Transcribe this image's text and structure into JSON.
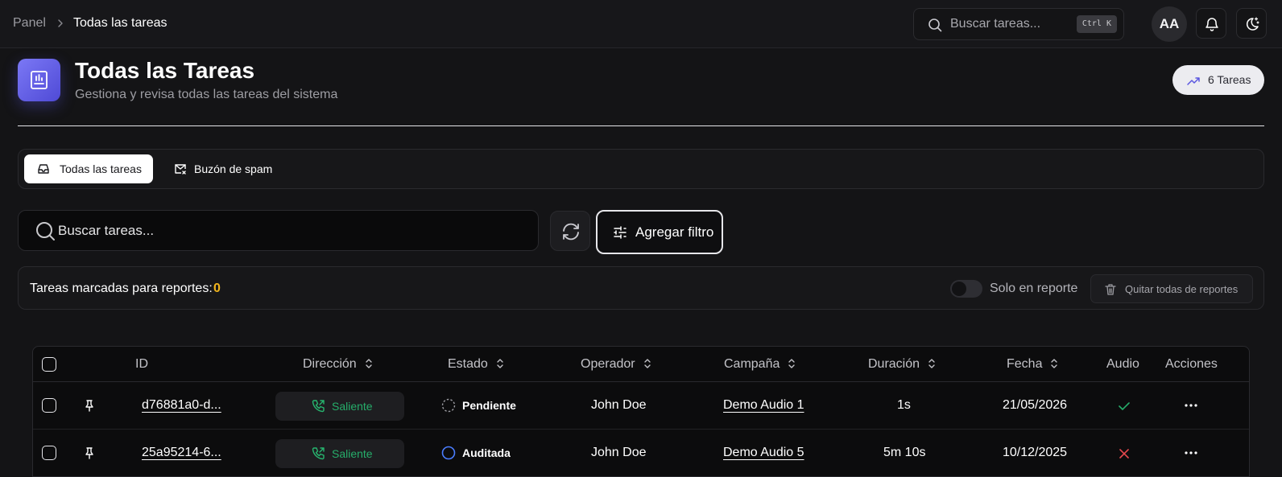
{
  "breadcrumb": {
    "parent": "Panel",
    "current": "Todas las tareas"
  },
  "top_search": {
    "placeholder": "Buscar tareas...",
    "shortcut": "Ctrl K"
  },
  "user": {
    "initials": "AA"
  },
  "header": {
    "title": "Todas las Tareas",
    "subtitle": "Gestiona y revisa todas las tareas del sistema",
    "count_label": "6 Tareas"
  },
  "tabs": [
    {
      "label": "Todas las tareas",
      "icon": "inbox-icon",
      "active": true
    },
    {
      "label": "Buzón de spam",
      "icon": "mail-x-icon",
      "active": false
    }
  ],
  "search": {
    "placeholder": "Buscar tareas..."
  },
  "filter_button": {
    "label": "Agregar filtro"
  },
  "report_bar": {
    "label": "Tareas marcadas para reportes:",
    "count": "0",
    "toggle_label": "Solo en reporte",
    "clear_label": "Quitar todas de reportes"
  },
  "table": {
    "columns": [
      "ID",
      "Dirección",
      "Estado",
      "Operador",
      "Campaña",
      "Duración",
      "Fecha",
      "Audio",
      "Acciones"
    ],
    "rows": [
      {
        "id": "d76881a0-d...",
        "direction": "Saliente",
        "status": "Pendiente",
        "status_icon": "dashed-circle-icon",
        "operator": "John Doe",
        "campaign": "Demo Audio 1",
        "duration": "1s",
        "date": "21/05/2026",
        "audio": "check-icon"
      },
      {
        "id": "25a95214-6...",
        "direction": "Saliente",
        "status": "Auditada",
        "status_icon": "circle-icon",
        "operator": "John Doe",
        "campaign": "Demo Audio 5",
        "duration": "5m 10s",
        "date": "10/12/2025",
        "audio": "x-icon"
      }
    ]
  },
  "colors": {
    "accent": "#5b57e0",
    "success": "#26ad6a",
    "warning": "#f2b51c",
    "audited": "#4a7dff",
    "error": "#e5484d"
  }
}
